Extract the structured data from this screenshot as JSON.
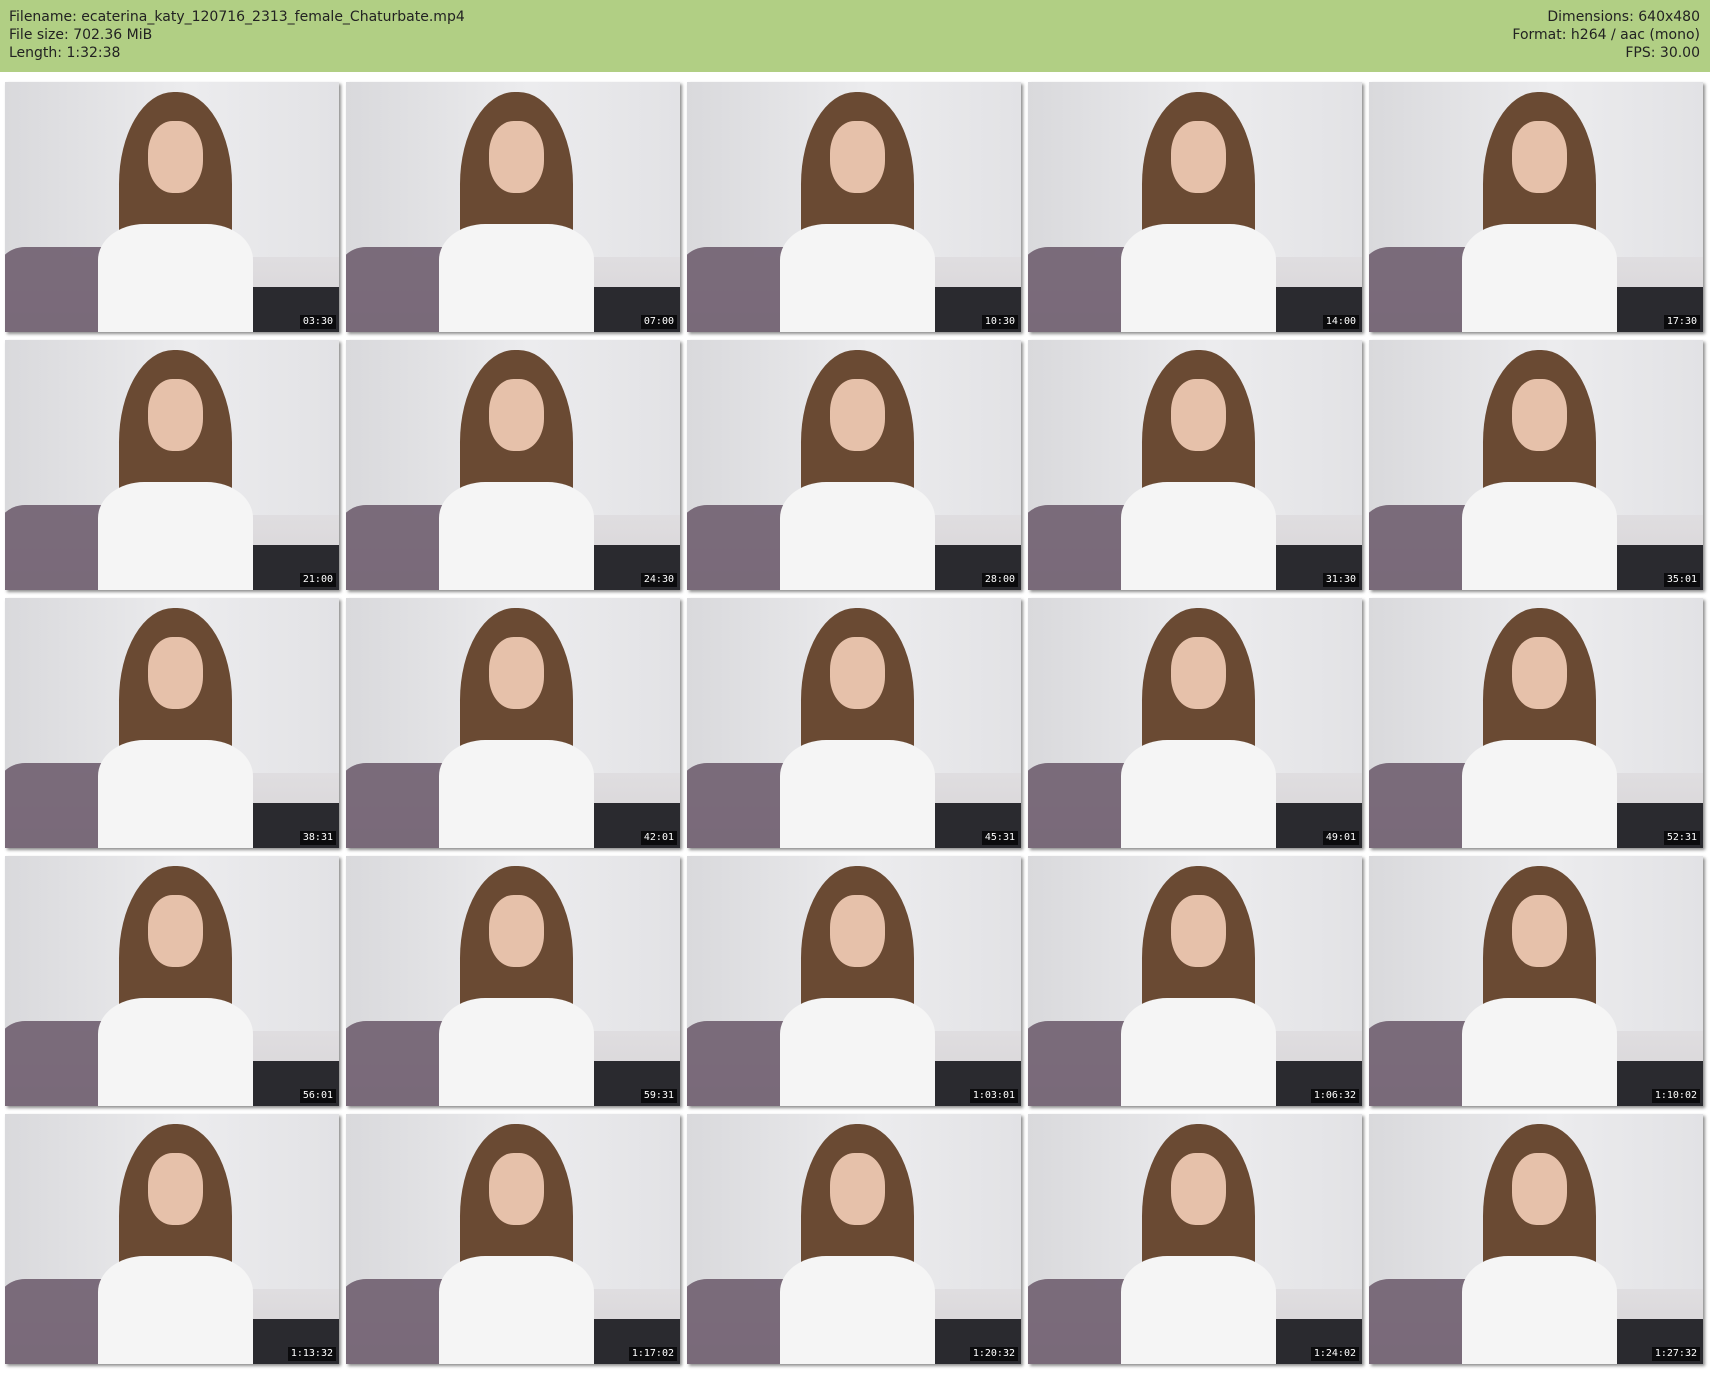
{
  "header": {
    "filename": "Filename: ecaterina_katy_120716_2313_female_Chaturbate.mp4",
    "file_size": "File size: 702.36 MiB",
    "length": "Length: 1:32:38",
    "dimensions": "Dimensions: 640x480",
    "format": "Format: h264 / aac (mono)",
    "fps": "FPS: 30.00"
  },
  "colors": {
    "header_bg": "#b1cf84",
    "timestamp_bg": "#000000",
    "timestamp_text": "#ffffff"
  },
  "thumbnails": [
    {
      "time": "03:30"
    },
    {
      "time": "07:00"
    },
    {
      "time": "10:30"
    },
    {
      "time": "14:00"
    },
    {
      "time": "17:30"
    },
    {
      "time": "21:00"
    },
    {
      "time": "24:30"
    },
    {
      "time": "28:00"
    },
    {
      "time": "31:30"
    },
    {
      "time": "35:01"
    },
    {
      "time": "38:31"
    },
    {
      "time": "42:01"
    },
    {
      "time": "45:31"
    },
    {
      "time": "49:01"
    },
    {
      "time": "52:31"
    },
    {
      "time": "56:01"
    },
    {
      "time": "59:31"
    },
    {
      "time": "1:03:01"
    },
    {
      "time": "1:06:32"
    },
    {
      "time": "1:10:02"
    },
    {
      "time": "1:13:32"
    },
    {
      "time": "1:17:02"
    },
    {
      "time": "1:20:32"
    },
    {
      "time": "1:24:02"
    },
    {
      "time": "1:27:32"
    }
  ]
}
